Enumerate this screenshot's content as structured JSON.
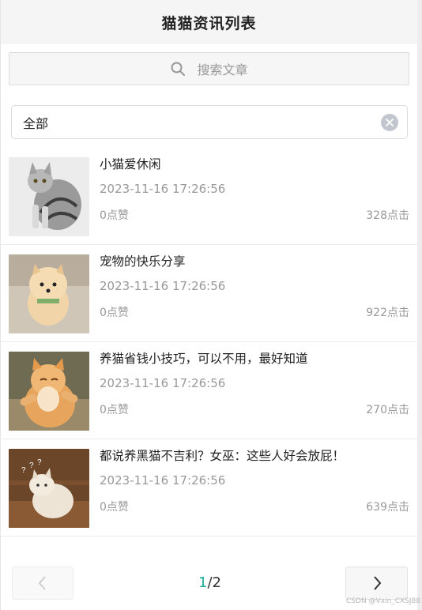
{
  "header": {
    "title": "猫猫资讯列表"
  },
  "search": {
    "placeholder": "搜索文章",
    "icon": "search-icon"
  },
  "filter": {
    "value": "全部",
    "clear_icon": "clear-icon"
  },
  "articles": [
    {
      "title": "小猫爱休闲",
      "date": "2023-11-16 17:26:56",
      "likes": "0点赞",
      "clicks": "328点击"
    },
    {
      "title": "宠物的快乐分享",
      "date": "2023-11-16 17:26:56",
      "likes": "0点赞",
      "clicks": "922点击"
    },
    {
      "title": "养猫省钱小技巧，可以不用，最好知道",
      "date": "2023-11-16 17:26:56",
      "likes": "0点赞",
      "clicks": "270点击"
    },
    {
      "title": "都说养黑猫不吉利？女巫：这些人好会放屁！",
      "date": "2023-11-16 17:26:56",
      "likes": "0点赞",
      "clicks": "639点击"
    }
  ],
  "pagination": {
    "current": "1",
    "total": "/2",
    "prev_icon": "chevron-left-icon",
    "next_icon": "chevron-right-icon"
  },
  "watermark": "CSDN @Vxin_CXSJ88",
  "colors": {
    "accent": "#1aad94",
    "muted_text": "#999999",
    "header_bg": "#f5f5f5"
  }
}
